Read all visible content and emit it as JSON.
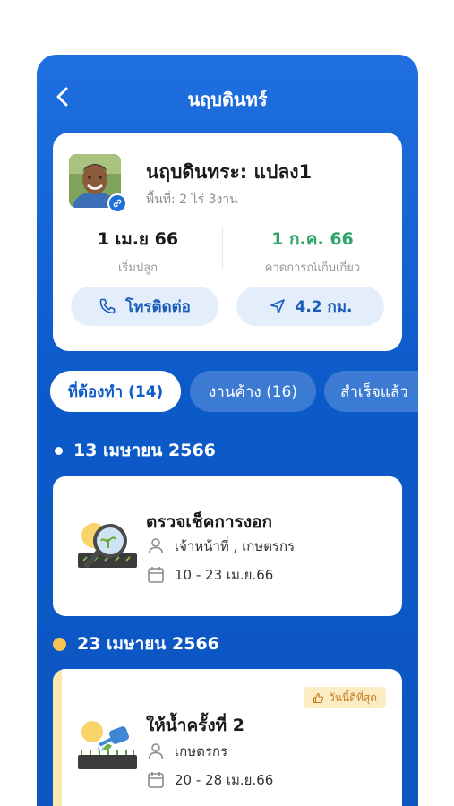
{
  "header": {
    "title": "นฤบดินทร์"
  },
  "profile": {
    "plot_name": "นฤบดินทระ: แปลง1",
    "area": "พื้นที่: 2 ไร่ 3งาน",
    "start": {
      "value": "1 เม.ย 66",
      "label": "เริ่มปลูก"
    },
    "harvest": {
      "value": "1 ก.ค. 66",
      "label": "คาดการณ์เก็บเกี่ยว"
    },
    "call_label": "โทรติดต่อ",
    "distance_label": "4.2 กม."
  },
  "tabs": [
    {
      "label": "ที่ต้องทำ (14)"
    },
    {
      "label": "งานค้าง (16)"
    },
    {
      "label": "สำเร็จแล้ว"
    }
  ],
  "groups": [
    {
      "date": "13 เมษายน 2566",
      "task": {
        "title": "ตรวจเช็คการงอก",
        "assignee": "เจ้าหน้าที่ , เกษตรกร",
        "date_range": "10 - 23 เม.ย.66"
      }
    },
    {
      "date": "23 เมษายน 2566",
      "task": {
        "title": "ให้น้ำครั้งที่ 2",
        "assignee": "เกษตรกร",
        "date_range": "20 - 28 เม.ย.66",
        "badge": "วันนี้ดีที่สุด"
      }
    }
  ],
  "colors": {
    "primary": "#0c5ac8",
    "harvest_green": "#2ea56a",
    "badge_bg": "#fbecc4",
    "badge_text": "#c27b1a"
  },
  "icons": [
    "back-arrow-icon",
    "link-icon",
    "phone-icon",
    "navigation-icon",
    "person-icon",
    "calendar-icon",
    "thumbs-up-icon"
  ]
}
